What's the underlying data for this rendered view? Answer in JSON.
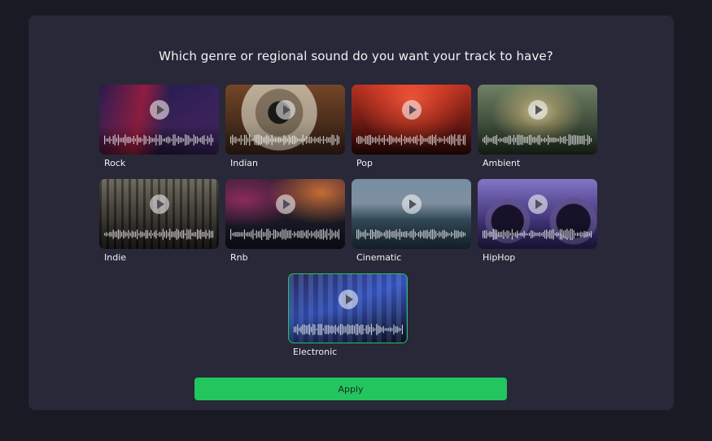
{
  "page": {
    "title": "Which genre or regional sound do you want your track to have?"
  },
  "genres": [
    {
      "label": "Rock",
      "selected": false
    },
    {
      "label": "Indian",
      "selected": false
    },
    {
      "label": "Pop",
      "selected": false
    },
    {
      "label": "Ambient",
      "selected": false
    },
    {
      "label": "Indie",
      "selected": false
    },
    {
      "label": "Rnb",
      "selected": false
    },
    {
      "label": "Cinematic",
      "selected": false
    },
    {
      "label": "HipHop",
      "selected": false
    },
    {
      "label": "Electronic",
      "selected": true
    }
  ],
  "actions": {
    "apply_label": "Apply"
  },
  "colors": {
    "accent": "#22c55e",
    "panel": "#282838",
    "background": "#1a1a24"
  },
  "icons": {
    "card_play": "play-icon",
    "card_waveform": "waveform-icon"
  }
}
